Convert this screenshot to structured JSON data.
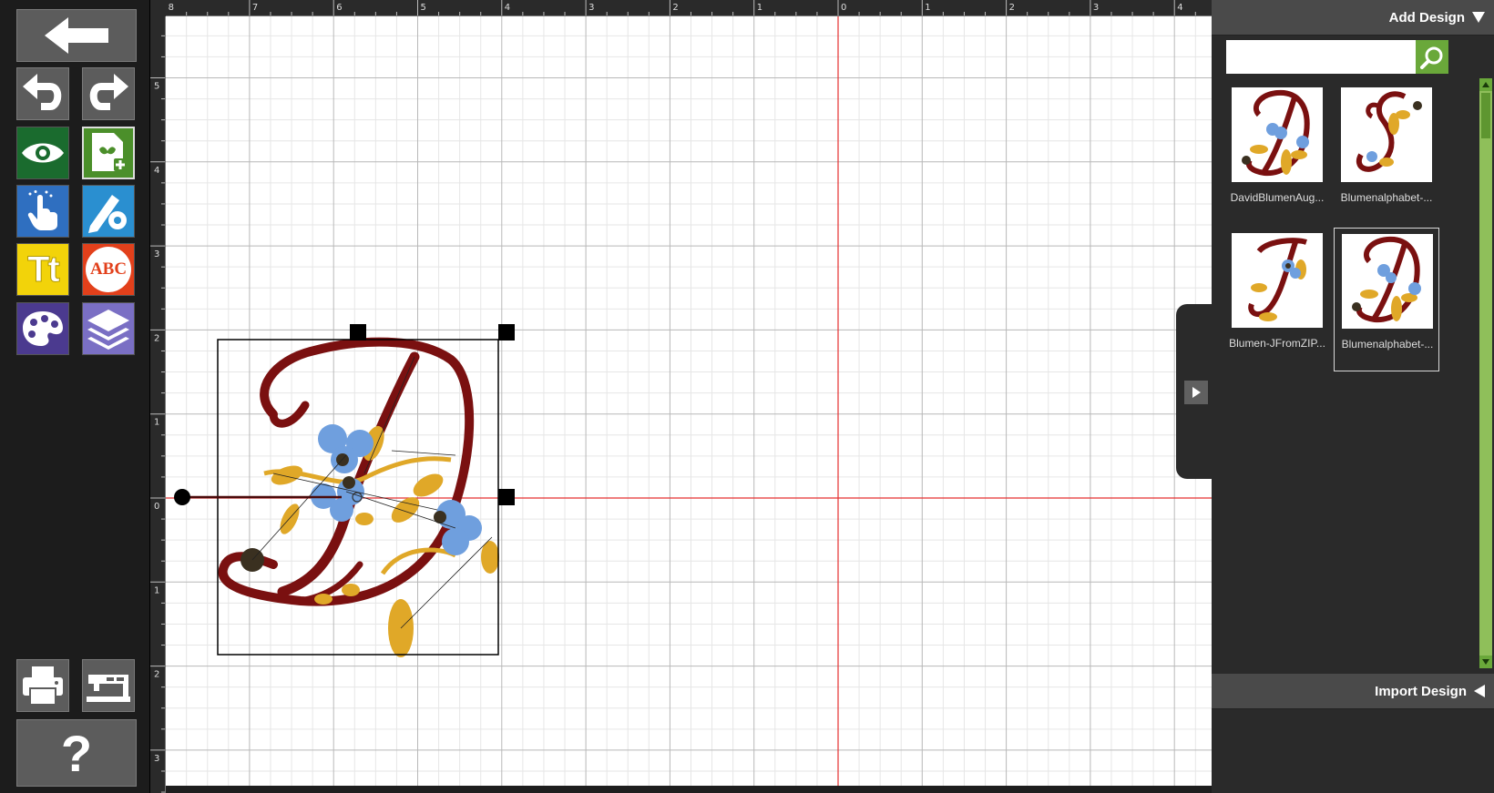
{
  "panel": {
    "add_design_label": "Add Design",
    "import_design_label": "Import Design",
    "search": {
      "value": "",
      "placeholder": ""
    },
    "designs": [
      {
        "name": "DavidBlumenAug...",
        "letter": "D",
        "selected": false
      },
      {
        "name": "Blumenalphabet-...",
        "letter": "S",
        "selected": false
      },
      {
        "name": "Blumen-JFromZIP...",
        "letter": "J",
        "selected": false
      },
      {
        "name": "Blumenalphabet-...",
        "letter": "D",
        "selected": true
      }
    ]
  },
  "toolbar": {
    "icons": [
      "back-arrow-icon",
      "undo-icon",
      "redo-icon",
      "eye-icon",
      "add-design-icon",
      "touch-select-icon",
      "edit-gear-icon",
      "text-icon",
      "monogram-icon",
      "palette-icon",
      "layers-icon",
      "print-icon",
      "sewing-machine-icon",
      "help-icon"
    ],
    "text_button_label": "Tt",
    "monogram_button_label": "ABC",
    "help_label": "?"
  },
  "ruler": {
    "top_labels": [
      "8",
      "7",
      "6",
      "5",
      "4",
      "3",
      "2",
      "1",
      "0",
      "1",
      "2",
      "3",
      "4"
    ],
    "left_labels": [
      "5",
      "4",
      "3",
      "2",
      "1",
      "0",
      "1",
      "2",
      "3"
    ]
  },
  "colors": {
    "accent_green": "#6aa83a",
    "origin_line": "#e53030",
    "design_red": "#7a1010",
    "design_gold": "#e0a828",
    "design_blue": "#6f9fde"
  }
}
